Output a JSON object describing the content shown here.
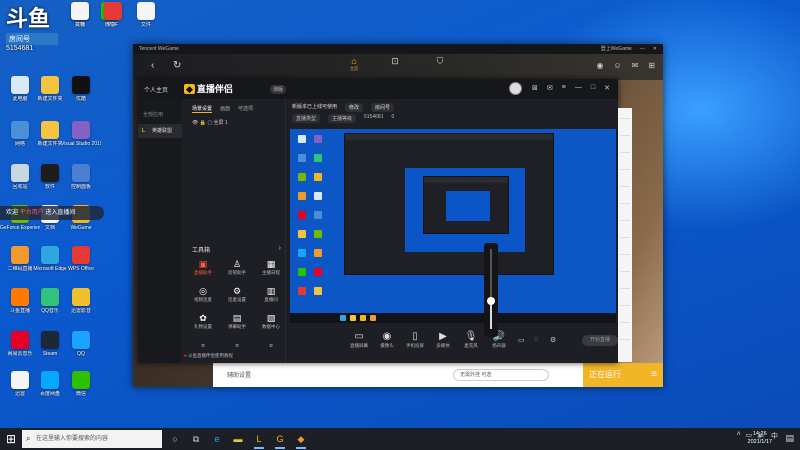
{
  "hud": {
    "big_text": "斗鱼",
    "label": "房间号",
    "number": "5154681"
  },
  "desktop": {
    "icons": [
      {
        "label": "此电脑",
        "icon": "computer-icon",
        "color": "#d9e8f7"
      },
      {
        "label": "网络",
        "icon": "network-icon",
        "color": "#4a90d9"
      },
      {
        "label": "回收站",
        "icon": "recycle-bin-icon",
        "color": "#c9d6e3"
      },
      {
        "label": "GeForce Experience",
        "icon": "nvidia-icon",
        "color": "#76b900"
      },
      {
        "label": "二维码直播",
        "icon": "app-icon",
        "color": "#f29a2e"
      },
      {
        "label": "斗鱼直播",
        "icon": "douyu-icon",
        "color": "#ff7a00"
      },
      {
        "label": "网易云音乐",
        "icon": "netease-music-icon",
        "color": "#e60026"
      },
      {
        "label": "迅雷",
        "icon": "xunlei-icon",
        "color": "#f5f5f5"
      },
      {
        "label": "新建文件夹",
        "icon": "folder-icon",
        "color": "#f4c441"
      },
      {
        "label": "新建文件夹",
        "icon": "folder-icon",
        "color": "#f4c441"
      },
      {
        "label": "软件",
        "icon": "app-icon",
        "color": "#1d1d1d"
      },
      {
        "label": "文档",
        "icon": "document-icon",
        "color": "#f5f5f5"
      },
      {
        "label": "Microsoft Edge",
        "icon": "edge-icon",
        "color": "#2ea6e0"
      },
      {
        "label": "QQ音乐",
        "icon": "qq-music-icon",
        "color": "#31c27c"
      },
      {
        "label": "Steam",
        "icon": "steam-icon",
        "color": "#1b2838"
      },
      {
        "label": "百度网盘",
        "icon": "baidu-pan-icon",
        "color": "#06a7ff"
      },
      {
        "label": "优酷",
        "icon": "youku-icon",
        "color": "#111111"
      },
      {
        "label": "Visual Studio 2019",
        "icon": "visual-studio-icon",
        "color": "#8661c5"
      },
      {
        "label": "控制面板",
        "icon": "control-panel-icon",
        "color": "#4a7fd3"
      },
      {
        "label": "WeGame",
        "icon": "wegame-icon",
        "color": "#f2b526"
      },
      {
        "label": "WPS Office",
        "icon": "wps-icon",
        "color": "#e53935"
      },
      {
        "label": "迅雷影音",
        "icon": "app-icon",
        "color": "#f0c030"
      },
      {
        "label": "QQ",
        "icon": "qq-icon",
        "color": "#1aa3ff"
      },
      {
        "label": "微信",
        "icon": "wechat-icon",
        "color": "#2dc100"
      },
      {
        "label": "抖音",
        "icon": "douyin-icon",
        "color": "#111111"
      },
      {
        "label": "微信",
        "icon": "wechat-icon",
        "color": "#2dc100"
      },
      {
        "label": "文档",
        "icon": "document-icon",
        "color": "#f5f5f5"
      },
      {
        "label": "PDF",
        "icon": "pdf-icon",
        "color": "#e53935"
      },
      {
        "label": "文件",
        "icon": "document-icon",
        "color": "#f5f5f5"
      }
    ],
    "toast": {
      "prefix": "欢迎",
      "user": "平台用户",
      "suffix": "进入直播间"
    }
  },
  "wegame": {
    "title": "Tencent WeGame",
    "user": "登上WeGame",
    "nav_back": "‹",
    "nav_refresh": "↻",
    "tabs": [
      {
        "label": "主页",
        "icon": "home-icon",
        "active": true
      },
      {
        "label": "",
        "icon": "inbox-icon",
        "active": false
      },
      {
        "label": "",
        "icon": "shop-icon",
        "active": false
      }
    ],
    "assist_label": "辅助设置",
    "search_placeholder": "无需外挂 可选",
    "running_label": "正在运行"
  },
  "live": {
    "home_label": "个人主页",
    "app_name": "直播伴侣",
    "version": "测版",
    "left_section": "全部应用",
    "left_item": "英雄联盟",
    "scene_tabs": [
      "场景设置",
      "画面",
      "可选项"
    ],
    "scene_row": "全屏 1",
    "tools_title": "工具箱",
    "tools": [
      {
        "label": "直播助手",
        "icon": "assistant-icon",
        "red": true
      },
      {
        "label": "房管助手",
        "icon": "admin-icon",
        "red": false
      },
      {
        "label": "主播日程",
        "icon": "schedule-icon",
        "red": false
      },
      {
        "label": "视频连麦",
        "icon": "video-link-icon",
        "red": false
      },
      {
        "label": "连麦设置",
        "icon": "link-settings-icon",
        "red": false
      },
      {
        "label": "直播间",
        "icon": "room-icon",
        "red": false
      },
      {
        "label": "礼物设置",
        "icon": "gift-icon",
        "red": false
      },
      {
        "label": "弹幕助手",
        "icon": "danmaku-icon",
        "red": false
      },
      {
        "label": "数据中心",
        "icon": "data-icon",
        "red": false
      },
      {
        "label": "",
        "icon": "more-icon",
        "red": false
      },
      {
        "label": "",
        "icon": "more-icon",
        "red": false
      },
      {
        "label": "",
        "icon": "more-icon",
        "red": false
      }
    ],
    "notice": "斗鱼直播伴侣使用教程",
    "title_row": [
      "新版本已上线可使用",
      "修改",
      "房间号"
    ],
    "stats": [
      "直播类型",
      "主播等级",
      "5154681",
      "0"
    ],
    "actions": [
      {
        "label": "直播屏幕",
        "icon": "screen-icon",
        "active": false
      },
      {
        "label": "摄像头",
        "icon": "camera-icon",
        "active": false
      },
      {
        "label": "手机投屏",
        "icon": "phone-cast-icon",
        "active": false
      },
      {
        "label": "多媒体",
        "icon": "media-icon",
        "active": false
      },
      {
        "label": "麦克风",
        "icon": "mic-icon",
        "active": false
      },
      {
        "label": "扬声器",
        "icon": "speaker-icon",
        "active": true
      }
    ],
    "start_label": "开始直播",
    "volume_level": 0.35
  },
  "taskbar": {
    "search_placeholder": "在这里输入你要搜索的内容",
    "apps": [
      {
        "icon": "cortana-icon",
        "open": false,
        "color": "#cccccc"
      },
      {
        "icon": "task-view-icon",
        "open": false,
        "color": "#cccccc"
      },
      {
        "icon": "edge-icon",
        "open": false,
        "color": "#2ea6e0"
      },
      {
        "icon": "file-explorer-icon",
        "open": false,
        "color": "#f4c441"
      },
      {
        "icon": "live-companion-icon",
        "open": true,
        "color": "#f2b526"
      },
      {
        "icon": "wegame-icon",
        "open": true,
        "color": "#f2b526"
      },
      {
        "icon": "app-icon",
        "open": true,
        "color": "#f29a2e"
      }
    ],
    "time": "14:26",
    "date": "2021/1/17"
  }
}
